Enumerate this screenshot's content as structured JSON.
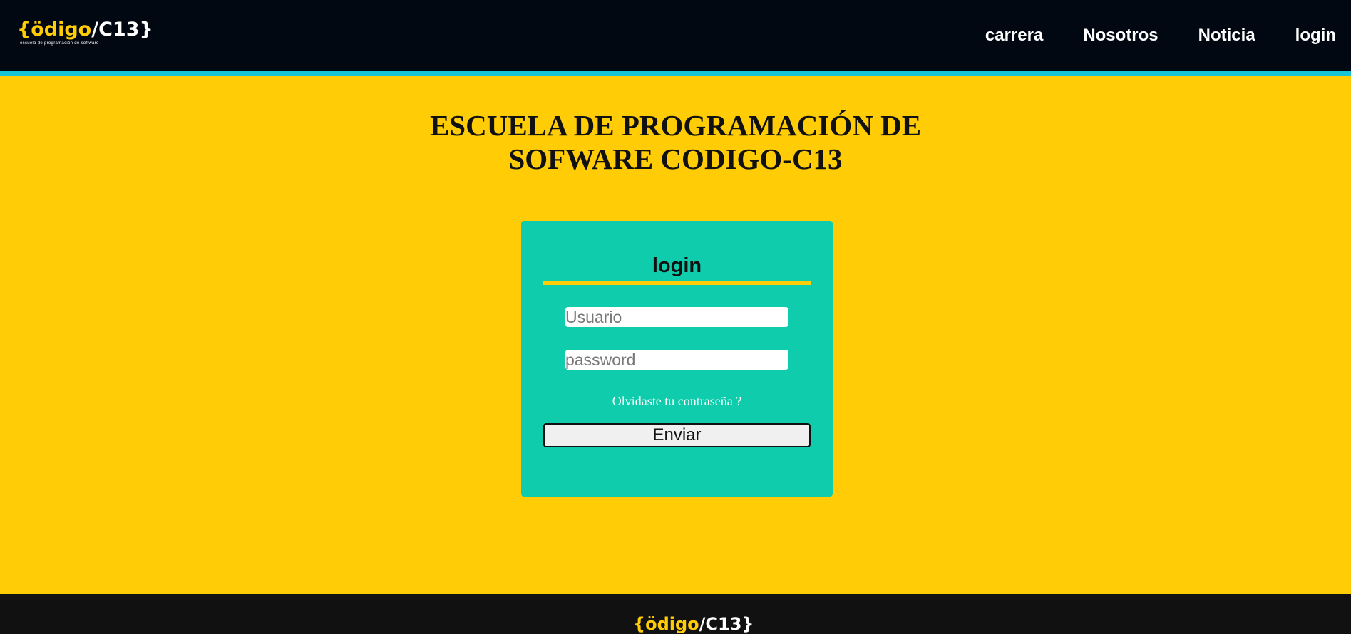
{
  "header": {
    "logo": {
      "brand_main": "{ödigo",
      "brand_slash": "/C13}",
      "tagline": "escuela de programación de software"
    },
    "nav": [
      {
        "label": "carrera"
      },
      {
        "label": "Nosotros"
      },
      {
        "label": "Noticia"
      },
      {
        "label": "login"
      }
    ]
  },
  "main": {
    "title_line1": "ESCUELA DE PROGRAMACIÓN DE",
    "title_line2": "SOFWARE CODIGO-C13"
  },
  "login_form": {
    "title": "login",
    "username_placeholder": "Usuario",
    "password_placeholder": "password",
    "forgot_link": "Olvidaste tu contraseña ?",
    "submit_label": "Enviar"
  },
  "footer": {
    "brand_main": "{ödigo",
    "brand_slash": "/C13}"
  },
  "colors": {
    "page_background": "#FFCC05",
    "header_background": "#010812",
    "header_accent": "#16C4D6",
    "card_background": "#0FCCAD",
    "footer_background": "#111112"
  }
}
